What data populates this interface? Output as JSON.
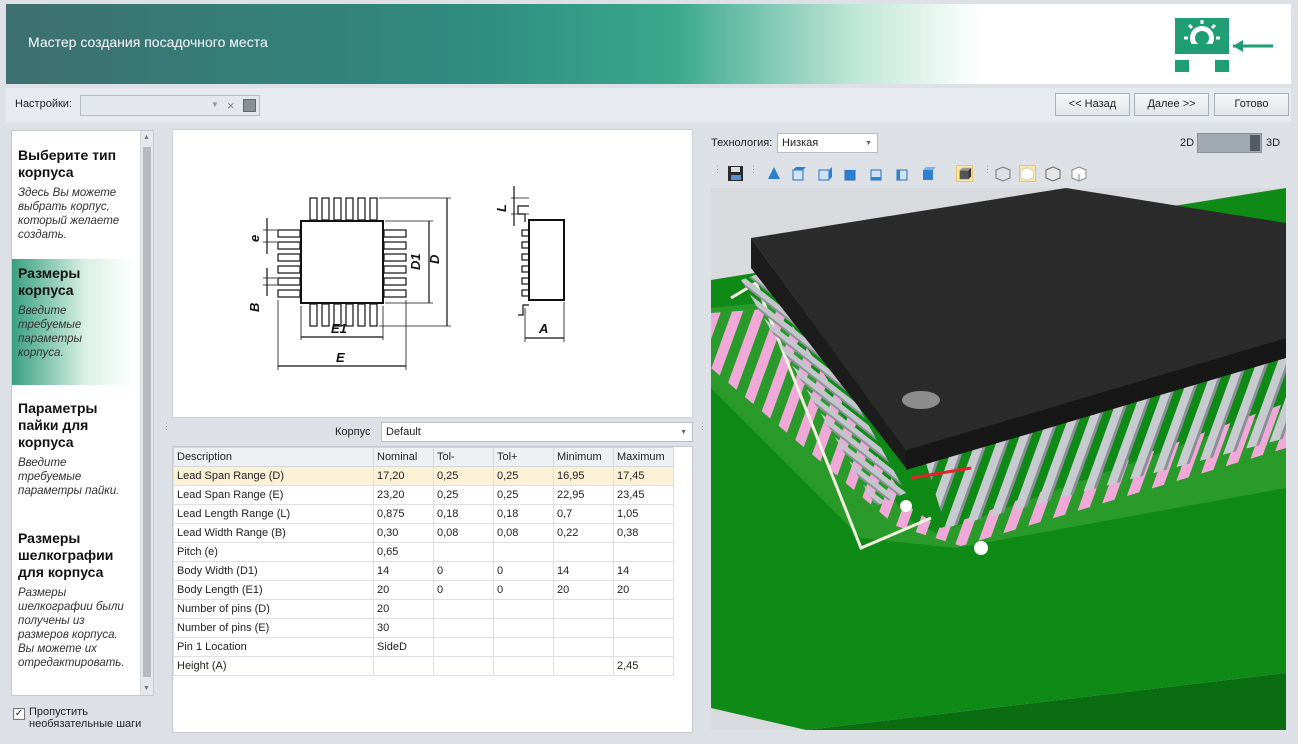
{
  "header": {
    "title": "Мастер создания посадочного места"
  },
  "toolbar": {
    "settings_label": "Настройки:",
    "settings_value": "",
    "back_label": "<< Назад",
    "next_label": "Далее >>",
    "done_label": "Готово"
  },
  "steps": [
    {
      "title": "Выберите тип корпуса",
      "desc": "Здесь Вы можете выбрать корпус, который желаете создать."
    },
    {
      "title": "Размеры корпуса",
      "desc": "Введите требуемые параметры корпуса."
    },
    {
      "title": "Параметры пайки для корпуса",
      "desc": "Введите требуемые параметры пайки."
    },
    {
      "title": "Размеры шелкографии для корпуса",
      "desc": "Размеры шелкографии были получены из размеров корпуса. Вы можете их отредактировать."
    }
  ],
  "skip": {
    "label": "Пропустить необязательные шаги",
    "checked": true
  },
  "drawing": {
    "labels": {
      "e": "e",
      "b": "B",
      "e1": "E1",
      "e_total": "E",
      "d1": "D1",
      "d": "D",
      "l": "L",
      "a": "A"
    }
  },
  "corpus": {
    "label": "Корпус",
    "value": "Default"
  },
  "table": {
    "columns": [
      "Description",
      "Nominal",
      "Tol-",
      "Tol+",
      "Minimum",
      "Maximum"
    ],
    "rows": [
      [
        "Lead Span Range (D)",
        "17,20",
        "0,25",
        "0,25",
        "16,95",
        "17,45"
      ],
      [
        "Lead Span Range (E)",
        "23,20",
        "0,25",
        "0,25",
        "22,95",
        "23,45"
      ],
      [
        "Lead Length Range (L)",
        "0,875",
        "0,18",
        "0,18",
        "0,7",
        "1,05"
      ],
      [
        "Lead Width Range (B)",
        "0,30",
        "0,08",
        "0,08",
        "0,22",
        "0,38"
      ],
      [
        "Pitch (e)",
        "0,65",
        "",
        "",
        "",
        ""
      ],
      [
        "Body Width (D1)",
        "14",
        "0",
        "0",
        "14",
        "14"
      ],
      [
        "Body Length (E1)",
        "20",
        "0",
        "0",
        "20",
        "20"
      ],
      [
        "Number of pins (D)",
        "20",
        "",
        "",
        "",
        ""
      ],
      [
        "Number of pins (E)",
        "30",
        "",
        "",
        "",
        ""
      ],
      [
        "Pin 1 Location",
        "SideD",
        "",
        "",
        "",
        ""
      ],
      [
        "Height (A)",
        "",
        "",
        "",
        "",
        "2,45"
      ]
    ]
  },
  "technology": {
    "label": "Технология:",
    "value": "Низкая"
  },
  "view_toggle": {
    "label_2d": "2D",
    "label_3d": "3D",
    "mode": "3D"
  },
  "colors": {
    "accent": "#2f8a80",
    "board": "#0f8a16",
    "chip": "#262626",
    "pads": "#f0a8d8"
  }
}
